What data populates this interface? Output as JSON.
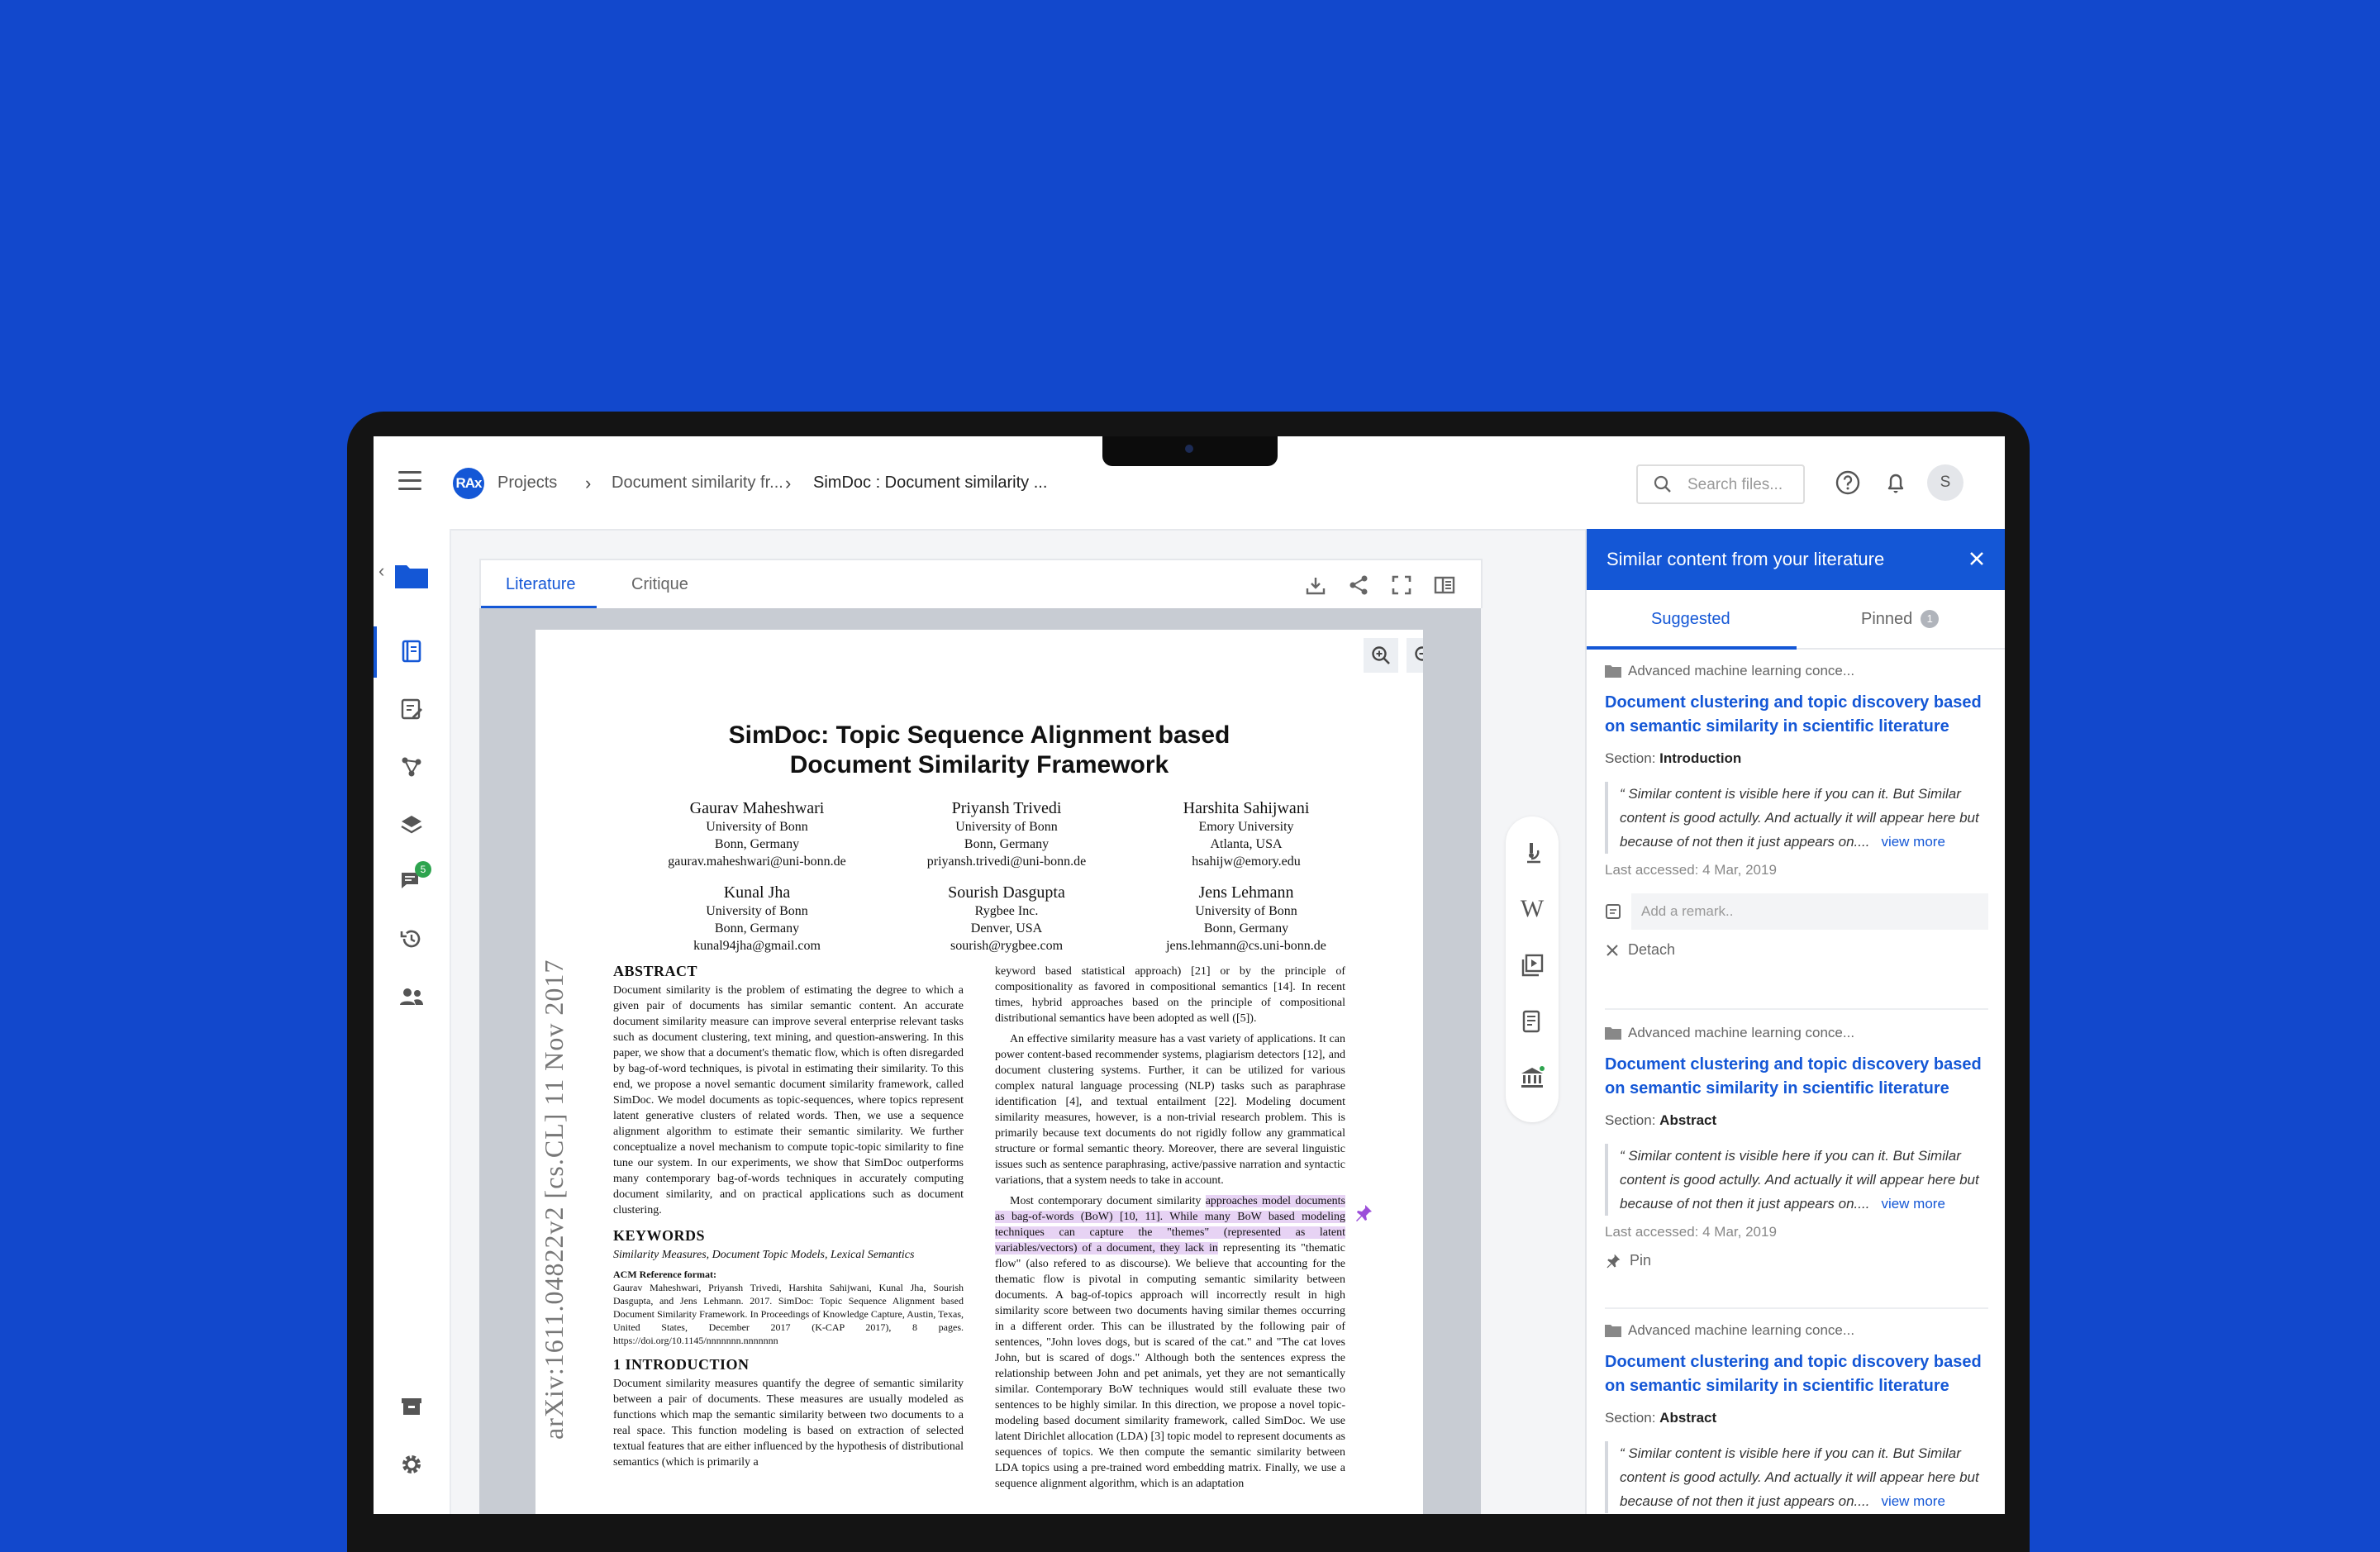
{
  "breadcrumbs": [
    "Projects",
    "Document similarity fr...",
    "SimDoc : Document similarity ..."
  ],
  "logo_text": "RAx",
  "search": {
    "placeholder": "Search files..."
  },
  "avatar_initial": "S",
  "rail": {
    "messages_badge": "5"
  },
  "viewer": {
    "tabs": [
      "Literature",
      "Critique"
    ],
    "paper": {
      "title_line1": "SimDoc: Topic Sequence Alignment based",
      "title_line2": "Document Similarity Framework",
      "authors": [
        {
          "name": "Gaurav Maheshwari",
          "lines": [
            "University of Bonn",
            "Bonn, Germany",
            "gaurav.maheshwari@uni-bonn.de"
          ]
        },
        {
          "name": "Priyansh Trivedi",
          "lines": [
            "University of Bonn",
            "Bonn, Germany",
            "priyansh.trivedi@uni-bonn.de"
          ]
        },
        {
          "name": "Harshita Sahijwani",
          "lines": [
            "Emory University",
            "Atlanta, USA",
            "hsahijw@emory.edu"
          ]
        },
        {
          "name": "Kunal Jha",
          "lines": [
            "University of Bonn",
            "Bonn, Germany",
            "kunal94jha@gmail.com"
          ]
        },
        {
          "name": "Sourish Dasgupta",
          "lines": [
            "Rygbee Inc.",
            "Denver, USA",
            "sourish@rygbee.com"
          ]
        },
        {
          "name": "Jens Lehmann",
          "lines": [
            "University of Bonn",
            "Bonn, Germany",
            "jens.lehmann@cs.uni-bonn.de"
          ]
        }
      ],
      "arxiv": "arXiv:1611.04822v2  [cs.CL]  11 Nov 2017",
      "abstract_heading": "ABSTRACT",
      "abstract": "Document similarity is the problem of estimating the degree to which a given pair of documents has similar semantic content. An accurate document similarity measure can improve several enterprise relevant tasks such as document clustering, text mining, and question-answering. In this paper, we show that a document's thematic flow, which is often disregarded by bag-of-word techniques, is pivotal in estimating their similarity. To this end, we propose a novel semantic document similarity framework, called SimDoc. We model documents as topic-sequences, where topics represent latent generative clusters of related words. Then, we use a sequence alignment algorithm to estimate their semantic similarity. We further conceptualize a novel mechanism to compute topic-topic similarity to fine tune our system. In our experiments, we show that SimDoc outperforms many contemporary bag-of-words techniques in accurately computing document similarity, and on practical applications such as document clustering.",
      "keywords_heading": "KEYWORDS",
      "keywords": "Similarity Measures, Document Topic Models, Lexical Semantics",
      "acm_heading": "ACM Reference format:",
      "acm_text": "Gaurav Maheshwari, Priyansh Trivedi, Harshita Sahijwani, Kunal Jha, Sourish Dasgupta, and Jens Lehmann. 2017. SimDoc: Topic Sequence Alignment based Document Similarity Framework. In Proceedings of Knowledge Capture, Austin, Texas, United States, December 2017 (K-CAP 2017), 8 pages. https://doi.org/10.1145/nnnnnnn.nnnnnnn",
      "intro_heading": "1   INTRODUCTION",
      "intro": "Document similarity measures quantify the degree of semantic similarity between a pair of documents. These measures are usually modeled as functions which map the semantic similarity between two documents to a real space. This function modeling is based on extraction of selected textual features that are either influenced by the hypothesis of distributional semantics (which is primarily a",
      "right_p1": "keyword based statistical approach) [21] or by the principle of compositionality as favored in compositional semantics [14]. In recent times, hybrid approaches based on the principle of compositional distributional semantics have been adopted as well ([5]).",
      "right_p2": "An effective similarity measure has a vast variety of applications. It can power content-based recommender systems, plagiarism detectors [12], and document clustering systems. Further, it can be utilized for various complex natural language processing (NLP) tasks such as paraphrase identification [4], and textual entailment [22]. Modeling document similarity measures, however, is a non-trivial research problem. This is primarily because text documents do not rigidly follow any grammatical structure or formal semantic theory. Moreover, there are several linguistic issues such as sentence paraphrasing, active/passive narration and syntactic variations, that a system needs to take in account.",
      "right_p3a": "Most contemporary document similarity ",
      "right_p3_hl": "approaches model documents as bag-of-words (BoW) [10, 11]. While many BoW based modeling techniques can capture the \"themes\" (represented as latent variables/vectors) of a document, they lack in",
      "right_p3b": " representing its \"thematic flow\" (also refered to as discourse). We believe that accounting for the thematic flow is pivotal in computing semantic similarity between documents. A bag-of-topics approach will incorrectly result in high similarity score between two documents having similar themes occurring in a different order. This can be illustrated by the following pair of sentences, \"John loves dogs, but is scared of the cat.\" and \"The cat loves John, but is scared of dogs.\" Although both the sentences express the relationship between John and pet animals, yet they are not semantically similar. Contemporary BoW techniques would still evaluate these two sentences to be highly similar. In this direction, we propose a novel topic-modeling based document similarity framework, called SimDoc. We use latent Dirichlet allocation (LDA) [3] topic model to represent documents as sequences of topics. We then compute the semantic similarity between LDA topics using a pre-trained word embedding matrix. Finally, we use a sequence alignment algorithm, which is an adaptation"
    }
  },
  "panel": {
    "title": "Similar content from your literature",
    "tabs": {
      "suggested": "Suggested",
      "pinned": "Pinned",
      "pinned_count": "1"
    },
    "cards": [
      {
        "folder": "Advanced machine learning conce...",
        "title": "Document clustering and topic discovery based on semantic similarity in scientific literature",
        "section_label": "Section:",
        "section": "Introduction",
        "quote": "“ Similar content is visible here if you can it. But Similar content is good actully. And actually it will appear here but because of not then it just appears on....",
        "view_more": "view more",
        "accessed": "Last accessed: 4 Mar, 2019",
        "remark_placeholder": "Add a remark..",
        "action": "Detach"
      },
      {
        "folder": "Advanced machine learning conce...",
        "title": "Document clustering and topic discovery based on semantic similarity in scientific literature",
        "section_label": "Section:",
        "section": "Abstract",
        "quote": "“ Similar content is visible here if you can it. But Similar content is good actully. And actually it will appear here but because of not then it just appears on....",
        "view_more": "view more",
        "accessed": "Last accessed: 4 Mar, 2019",
        "action": "Pin"
      },
      {
        "folder": "Advanced machine learning conce...",
        "title": "Document clustering and topic discovery based on semantic similarity in scientific literature",
        "section_label": "Section:",
        "section": "Abstract",
        "quote": "“ Similar content is visible here if you can it. But Similar content is good actully. And actually it will appear here but because of not then it just appears on....",
        "view_more": "view more"
      }
    ]
  },
  "colors": {
    "background": "#1248cc",
    "accent": "#1457d6",
    "highlight": "#e7d3f4"
  }
}
